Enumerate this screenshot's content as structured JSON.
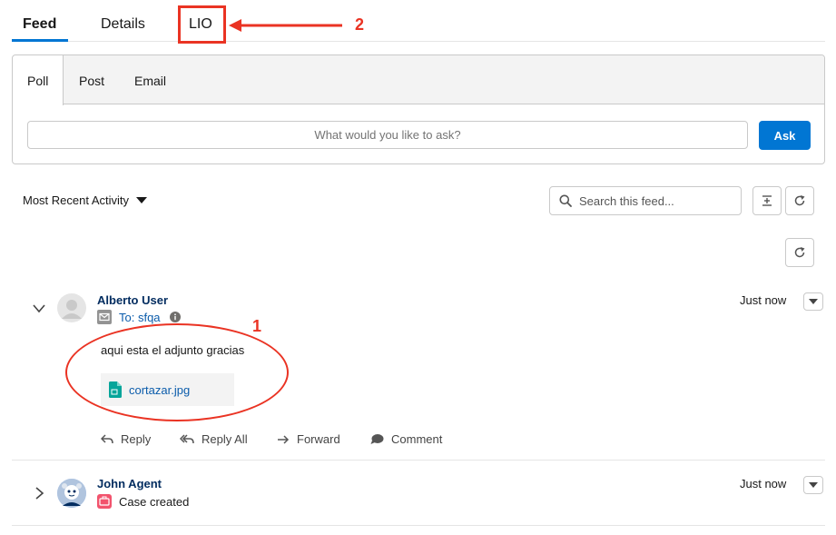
{
  "tabs": {
    "feed": "Feed",
    "details": "Details",
    "lio": "LIO"
  },
  "annotations": {
    "label_1": "1",
    "label_2": "2",
    "color": "#ea3323"
  },
  "publisher": {
    "tabs": [
      "Poll",
      "Post",
      "Email"
    ],
    "ask_placeholder": "What would you like to ask?",
    "ask_button": "Ask"
  },
  "toolbar": {
    "sort_label": "Most Recent Activity",
    "search_placeholder": "Search this feed..."
  },
  "feed": [
    {
      "author": "Alberto User",
      "timestamp": "Just now",
      "meta_label": "To: sfqa",
      "meta_icon": "email-icon",
      "body": "aqui esta el adjunto gracias",
      "attachment": "cortazar.jpg",
      "actions": [
        "Reply",
        "Reply All",
        "Forward",
        "Comment"
      ]
    },
    {
      "author": "John Agent",
      "timestamp": "Just now",
      "meta_label": "Case created",
      "meta_icon": "case-icon"
    }
  ],
  "colors": {
    "accent": "#0176d3",
    "author": "#032d60",
    "link": "#0b5cab",
    "case_icon": "#f2536d",
    "attachment_icon": "#06a59a"
  }
}
